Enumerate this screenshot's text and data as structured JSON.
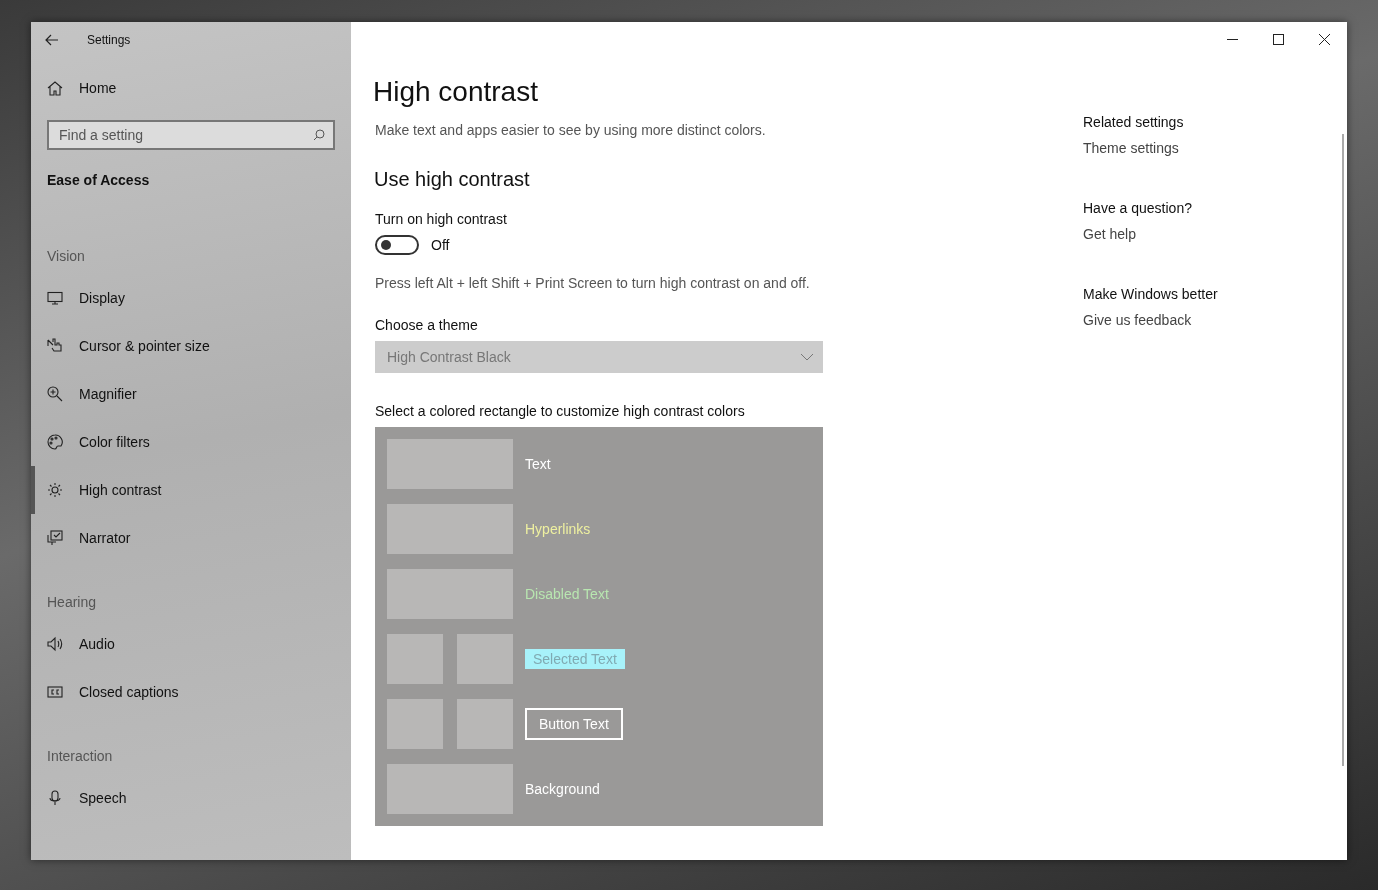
{
  "window": {
    "title": "Settings"
  },
  "sidebar": {
    "home": "Home",
    "search": {
      "placeholder": "Find a setting"
    },
    "category": "Ease of Access",
    "groups": [
      {
        "heading": "Vision",
        "items": [
          {
            "label": "Display",
            "selected": false
          },
          {
            "label": "Cursor & pointer size",
            "selected": false
          },
          {
            "label": "Magnifier",
            "selected": false
          },
          {
            "label": "Color filters",
            "selected": false
          },
          {
            "label": "High contrast",
            "selected": true
          },
          {
            "label": "Narrator",
            "selected": false
          }
        ]
      },
      {
        "heading": "Hearing",
        "items": [
          {
            "label": "Audio",
            "selected": false
          },
          {
            "label": "Closed captions",
            "selected": false
          }
        ]
      },
      {
        "heading": "Interaction",
        "items": [
          {
            "label": "Speech",
            "selected": false
          }
        ]
      }
    ]
  },
  "page": {
    "title": "High contrast",
    "description": "Make text and apps easier to see by using more distinct colors.",
    "section": "Use high contrast",
    "toggle": {
      "label": "Turn on high contrast",
      "on": false,
      "state_text": "Off"
    },
    "shortcut_hint": "Press left Alt + left Shift + Print Screen to turn high contrast on and off.",
    "theme": {
      "label": "Choose a theme",
      "value": "High Contrast Black",
      "disabled": true
    },
    "colors_label": "Select a colored rectangle to customize high contrast colors",
    "color_rows": [
      {
        "kind": "text",
        "label": "Text",
        "color": "#ffffff"
      },
      {
        "kind": "text",
        "label": "Hyperlinks",
        "color": "#eef0a0"
      },
      {
        "kind": "text",
        "label": "Disabled Text",
        "color": "#b8e6b0"
      },
      {
        "kind": "selection",
        "label": "Selected Text",
        "color": "#a8f2fa"
      },
      {
        "kind": "button",
        "label": "Button Text",
        "color": "#ffffff"
      },
      {
        "kind": "text",
        "label": "Background",
        "color": "#ffffff"
      }
    ]
  },
  "related": [
    {
      "heading": "Related settings",
      "link": "Theme settings"
    },
    {
      "heading": "Have a question?",
      "link": "Get help"
    },
    {
      "heading": "Make Windows better",
      "link": "Give us feedback"
    }
  ]
}
